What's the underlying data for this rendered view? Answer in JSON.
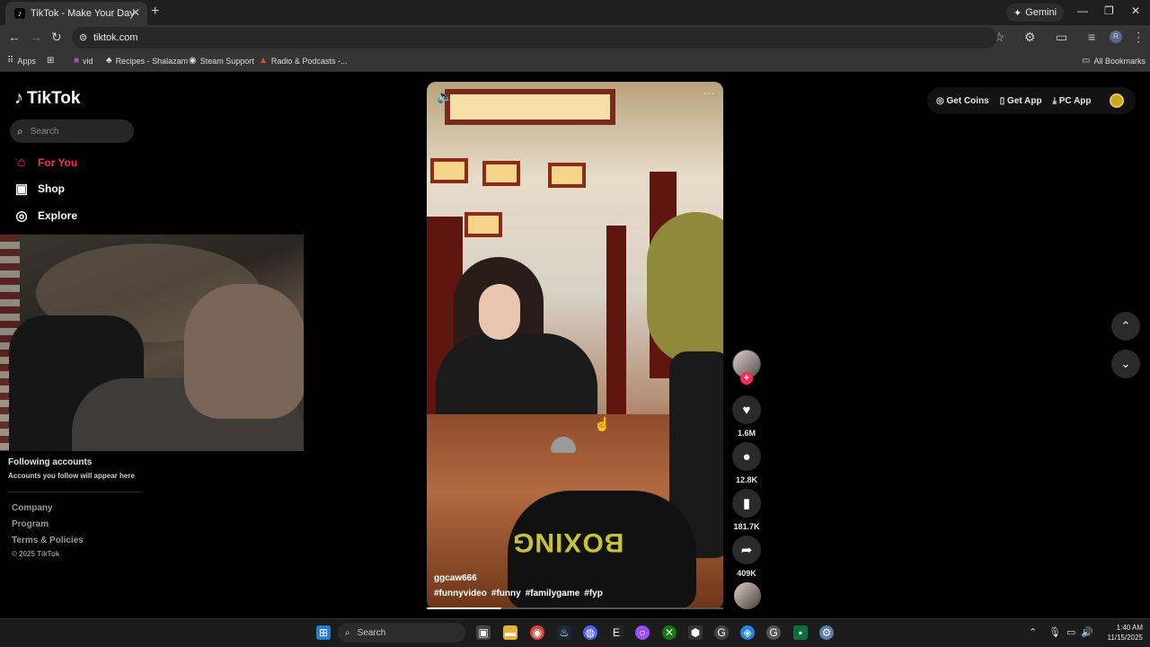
{
  "browser": {
    "tab_title": "TikTok - Make Your Day",
    "tab_close": "✕",
    "new_tab": "+",
    "gemini_label": "Gemini",
    "url": "tiktok.com",
    "bookmarks": [
      "Apps",
      "vid",
      "Recipes - Shalazam",
      "Steam Support",
      "Radio & Podcasts -..."
    ],
    "all_bookmarks": "All Bookmarks",
    "profile_initial": "R"
  },
  "sidebar": {
    "logo": "TikTok",
    "search_placeholder": "Search",
    "nav": [
      "For You",
      "Shop",
      "Explore"
    ],
    "accent_color": "#fe2c55",
    "following_title": "Following accounts",
    "following_sub": "Accounts you follow will appear here",
    "footer_links": [
      "Company",
      "Program",
      "Terms & Policies"
    ],
    "copyright": "© 2025 TikTok"
  },
  "video": {
    "author": "ggcaw666",
    "hashtags": [
      "#funnyvideo",
      "#funny",
      "#familygame",
      "#fyp"
    ],
    "glove_text": "BOXING",
    "progress": 0.25
  },
  "actions": {
    "likes": "1.6M",
    "comments": "12.8K",
    "saves": "181.7K",
    "shares": "409K",
    "follow_plus": "+"
  },
  "topright": {
    "get_coins": "Get Coins",
    "get_app": "Get App",
    "pc_app": "PC App"
  },
  "taskbar": {
    "search": "Search",
    "time": "1:40 AM",
    "date": "11/15/2025"
  }
}
